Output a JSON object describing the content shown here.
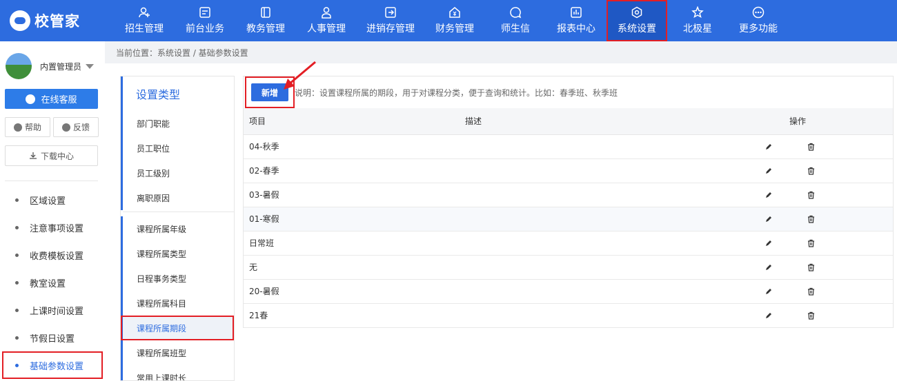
{
  "brand": {
    "name": "校管家"
  },
  "nav": [
    {
      "label": "招生管理",
      "icon": "person-add-icon"
    },
    {
      "label": "前台业务",
      "icon": "screen-icon"
    },
    {
      "label": "教务管理",
      "icon": "book-icon"
    },
    {
      "label": "人事管理",
      "icon": "person-icon"
    },
    {
      "label": "进销存管理",
      "icon": "inventory-icon"
    },
    {
      "label": "财务管理",
      "icon": "finance-icon"
    },
    {
      "label": "师生信",
      "icon": "chat-icon"
    },
    {
      "label": "报表中心",
      "icon": "chart-icon"
    },
    {
      "label": "系统设置",
      "icon": "settings-icon"
    },
    {
      "label": "北极星",
      "icon": "star-icon"
    },
    {
      "label": "更多功能",
      "icon": "more-icon"
    }
  ],
  "sidebar": {
    "user_name": "内置管理员",
    "service_label": "在线客服",
    "help_label": "帮助",
    "feedback_label": "反馈",
    "download_label": "下载中心",
    "menu": [
      {
        "label": "区域设置"
      },
      {
        "label": "注意事项设置"
      },
      {
        "label": "收费模板设置"
      },
      {
        "label": "教室设置"
      },
      {
        "label": "上课时间设置"
      },
      {
        "label": "节假日设置"
      },
      {
        "label": "基础参数设置"
      }
    ]
  },
  "breadcrumb": "当前位置：系统设置 / 基础参数设置",
  "types": {
    "title": "设置类型",
    "group1": [
      "部门职能",
      "员工职位",
      "员工级别",
      "离职原因"
    ],
    "group2": [
      "课程所属年级",
      "课程所属类型",
      "日程事务类型",
      "课程所属科目",
      "课程所属期段",
      "课程所属班型",
      "常用上课时长"
    ]
  },
  "main": {
    "add_label": "新增",
    "note": "说明：设置课程所属的期段，用于对课程分类，便于查询和统计。比如：春季班、秋季班",
    "columns": {
      "item": "项目",
      "desc": "描述",
      "ops": "操作"
    },
    "rows": [
      {
        "item": "04-秋季",
        "desc": ""
      },
      {
        "item": "02-春季",
        "desc": ""
      },
      {
        "item": "03-暑假",
        "desc": ""
      },
      {
        "item": "01-寒假",
        "desc": ""
      },
      {
        "item": "日常班",
        "desc": ""
      },
      {
        "item": "无",
        "desc": ""
      },
      {
        "item": "20-暑假",
        "desc": ""
      },
      {
        "item": "21春",
        "desc": ""
      }
    ]
  },
  "colors": {
    "primary": "#2d6cdf",
    "highlight": "#e31e24"
  }
}
